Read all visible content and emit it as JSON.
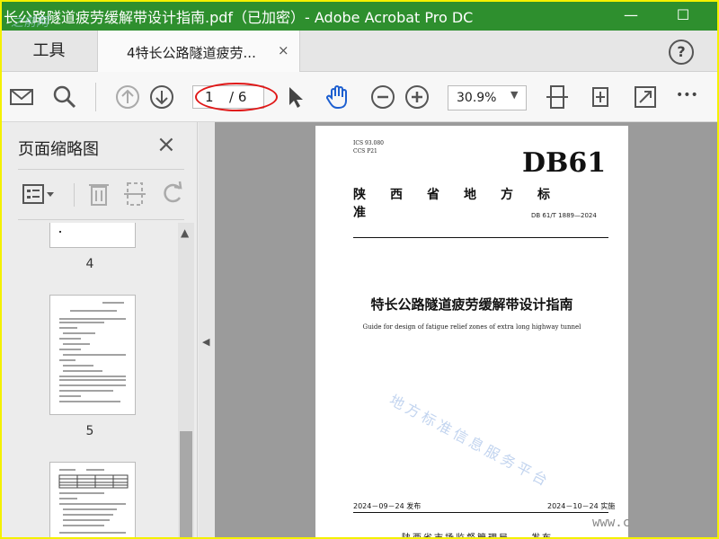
{
  "window": {
    "title": "长公路隧道疲劳缓解带设计指南.pdf（已加密）- Adobe Acrobat Pro DC",
    "watermark_top": "之前网"
  },
  "tabs": {
    "tools_label": "工具",
    "doc_label": "4特长公路隧道疲劳...",
    "close_glyph": "×",
    "help_glyph": "?"
  },
  "toolbar": {
    "page_current": "1",
    "page_total": "/ 6",
    "zoom": "30.9%",
    "more_glyph": "•••",
    "icons": [
      "mail-icon",
      "search-icon",
      "page-up-icon",
      "page-down-icon",
      "select-pointer-icon",
      "hand-icon",
      "zoom-out-icon",
      "zoom-in-icon",
      "fit-page-icon",
      "rotate-view-icon",
      "fullscreen-icon",
      "more-icon"
    ]
  },
  "panel": {
    "title": "页面缩略图",
    "close_glyph": "×",
    "thumbnails": [
      {
        "number": "4"
      },
      {
        "number": "5"
      }
    ]
  },
  "document": {
    "ics": "ICS 93.080",
    "ccs": "CCS P21",
    "code": "DB61",
    "standard_type": "陕西省地方标准",
    "std_number": "DB 61/T 1889—2024",
    "title_cn": "特长公路隧道疲劳缓解带设计指南",
    "title_en": "Guide for design of fatigue relief zones of extra long highway tunnel",
    "watermark": "地方标准信息服务平台",
    "publish_date": "2024－09－24 发布",
    "implement_date": "2024－10－24 实施",
    "issuer": "陕西省市场监督管理局",
    "issue_verb": "发布",
    "side_text": "www.c"
  },
  "colors": {
    "titlebar": "#2e8f2e",
    "frame_border": "#f4f100",
    "annotation_oval": "#e01818",
    "icon_blue": "#1d5fd0"
  }
}
